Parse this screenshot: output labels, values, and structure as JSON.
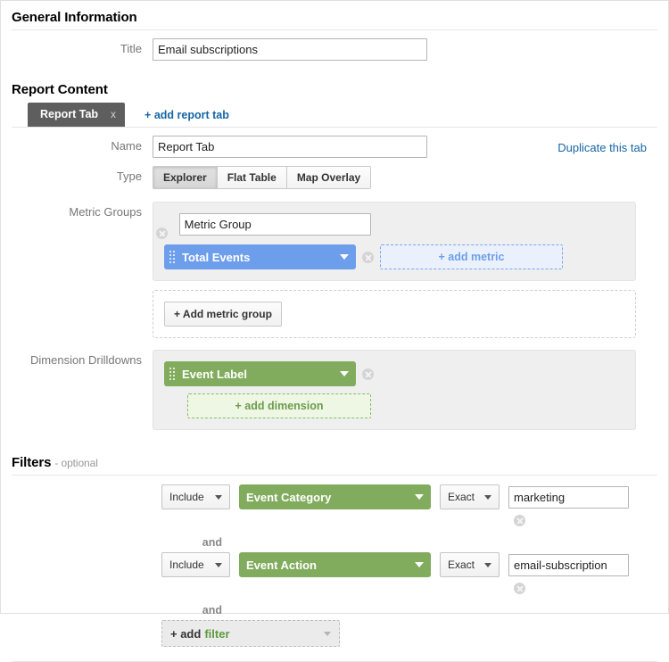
{
  "general": {
    "heading": "General Information",
    "title_label": "Title",
    "title_value": "Email subscriptions"
  },
  "report_content": {
    "heading": "Report Content",
    "tab_label": "Report Tab",
    "tab_close_icon": "x",
    "add_report_tab": "+ add report tab",
    "duplicate_link": "Duplicate this tab",
    "name_label": "Name",
    "name_value": "Report Tab",
    "type_label": "Type",
    "types": [
      {
        "label": "Explorer",
        "selected": true
      },
      {
        "label": "Flat Table",
        "selected": false
      },
      {
        "label": "Map Overlay",
        "selected": false
      }
    ]
  },
  "metric_groups": {
    "label": "Metric Groups",
    "group_name_value": "Metric Group",
    "metric_pill": "Total Events",
    "add_metric": "+ add metric",
    "add_metric_group": "+ Add metric group",
    "pill_color": "#6d9eeb"
  },
  "dimension_drilldowns": {
    "label": "Dimension Drilldowns",
    "dimension_pill": "Event Label",
    "add_dimension": "+ add dimension",
    "pill_color": "#81ac5d"
  },
  "filters": {
    "heading": "Filters",
    "heading_optional": "- optional",
    "and_label": "and",
    "rows": [
      {
        "include": "Include",
        "field": "Event Category",
        "match": "Exact",
        "value": "marketing"
      },
      {
        "include": "Include",
        "field": "Event Action",
        "match": "Exact",
        "value": "email-subscription"
      }
    ],
    "add_filter_prefix": "+ add",
    "add_filter_word": "filter"
  }
}
